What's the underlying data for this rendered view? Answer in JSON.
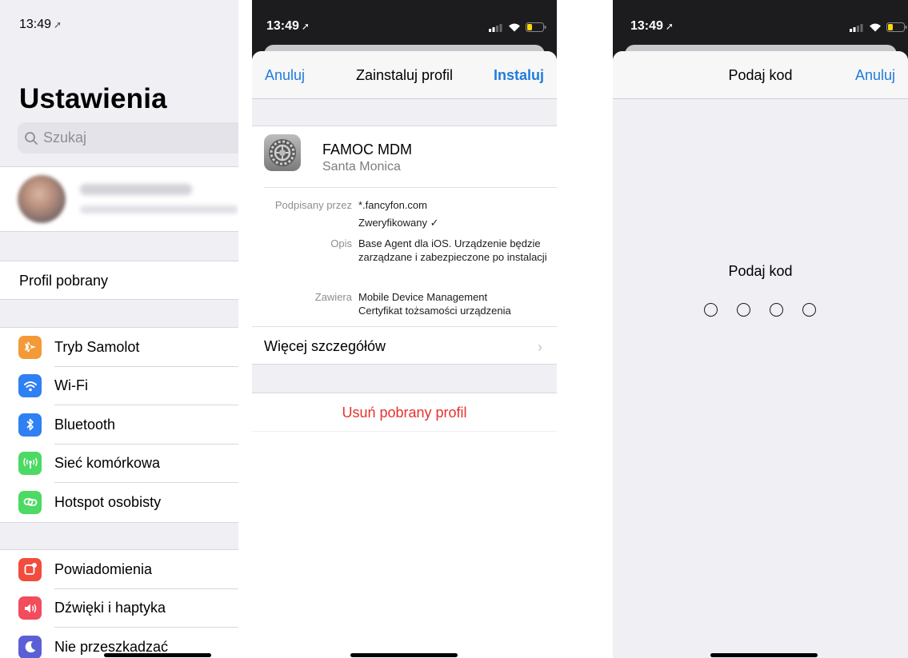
{
  "settings": {
    "time": "13:49",
    "title": "Ustawienia",
    "search_placeholder": "Szukaj",
    "downloaded_profile": "Profil pobrany",
    "group1": [
      {
        "label": "Tryb Samolot",
        "icon": "airplane-icon",
        "color": "#f39a37"
      },
      {
        "label": "Wi-Fi",
        "icon": "wifi-icon",
        "color": "#2f80f2"
      },
      {
        "label": "Bluetooth",
        "icon": "bluetooth-icon",
        "color": "#2f80f2"
      },
      {
        "label": "Sieć komórkowa",
        "icon": "cellular-icon",
        "color": "#4cd964"
      },
      {
        "label": "Hotspot osobisty",
        "icon": "hotspot-icon",
        "color": "#4cd964"
      }
    ],
    "group2": [
      {
        "label": "Powiadomienia",
        "icon": "notifications-icon",
        "color": "#f24c3d"
      },
      {
        "label": "Dźwięki i haptyka",
        "icon": "sounds-icon",
        "color": "#f24c5d"
      },
      {
        "label": "Nie przeszkadzać",
        "icon": "moon-icon",
        "color": "#5b5fd6"
      }
    ]
  },
  "install": {
    "time": "13:49",
    "cancel": "Anuluj",
    "title": "Zainstaluj profil",
    "install": "Instaluj",
    "profile_name": "FAMOC MDM",
    "profile_org": "Santa Monica",
    "signed_label": "Podpisany przez",
    "signed_value": "*.fancyfon.com",
    "verified": "Zweryfikowany ✓",
    "desc_label": "Opis",
    "desc_value": "Base Agent dla iOS. Urządzenie będzie zarządzane i zabezpieczone po instalacji",
    "contains_label": "Zawiera",
    "contains_value_1": "Mobile Device Management",
    "contains_value_2": "Certyfikat tożsamości urządzenia",
    "more_details": "Więcej szczegółów",
    "remove": "Usuń pobrany profil"
  },
  "passcode": {
    "time": "13:49",
    "title": "Podaj kod",
    "cancel": "Anuluj",
    "prompt": "Podaj kod",
    "digits": 4
  }
}
